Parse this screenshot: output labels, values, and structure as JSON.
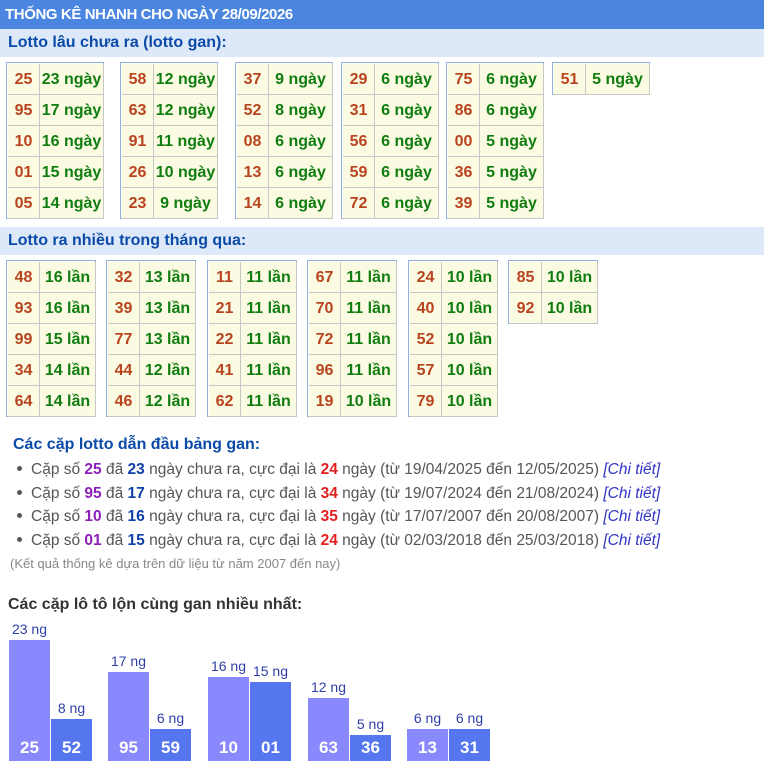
{
  "header": {
    "title": "THỐNG KÊ NHANH CHO NGÀY 28/09/2026"
  },
  "gan": {
    "title": "Lotto lâu chưa ra (lotto gan):",
    "groups": [
      [
        {
          "num": "25",
          "val": "23 ngày"
        },
        {
          "num": "95",
          "val": "17 ngày"
        },
        {
          "num": "10",
          "val": "16 ngày"
        },
        {
          "num": "01",
          "val": "15 ngày"
        },
        {
          "num": "05",
          "val": "14 ngày"
        }
      ],
      [
        {
          "num": "58",
          "val": "12 ngày"
        },
        {
          "num": "63",
          "val": "12 ngày"
        },
        {
          "num": "91",
          "val": "11 ngày"
        },
        {
          "num": "26",
          "val": "10 ngày"
        },
        {
          "num": "23",
          "val": "9 ngày"
        }
      ],
      [
        {
          "num": "37",
          "val": "9 ngày"
        },
        {
          "num": "52",
          "val": "8 ngày"
        },
        {
          "num": "08",
          "val": "6 ngày"
        },
        {
          "num": "13",
          "val": "6 ngày"
        },
        {
          "num": "14",
          "val": "6 ngày"
        }
      ],
      [
        {
          "num": "29",
          "val": "6 ngày"
        },
        {
          "num": "31",
          "val": "6 ngày"
        },
        {
          "num": "56",
          "val": "6 ngày"
        },
        {
          "num": "59",
          "val": "6 ngày"
        },
        {
          "num": "72",
          "val": "6 ngày"
        }
      ],
      [
        {
          "num": "75",
          "val": "6 ngày"
        },
        {
          "num": "86",
          "val": "6 ngày"
        },
        {
          "num": "00",
          "val": "5 ngày"
        },
        {
          "num": "36",
          "val": "5 ngày"
        },
        {
          "num": "39",
          "val": "5 ngày"
        }
      ],
      [
        {
          "num": "51",
          "val": "5 ngày"
        }
      ]
    ]
  },
  "frequent": {
    "title": "Lotto ra nhiều trong tháng qua:",
    "groups": [
      [
        {
          "num": "48",
          "val": "16 lần"
        },
        {
          "num": "93",
          "val": "16 lần"
        },
        {
          "num": "99",
          "val": "15 lần"
        },
        {
          "num": "34",
          "val": "14 lần"
        },
        {
          "num": "64",
          "val": "14 lần"
        }
      ],
      [
        {
          "num": "32",
          "val": "13 lần"
        },
        {
          "num": "39",
          "val": "13 lần"
        },
        {
          "num": "77",
          "val": "13 lần"
        },
        {
          "num": "44",
          "val": "12 lần"
        },
        {
          "num": "46",
          "val": "12 lần"
        }
      ],
      [
        {
          "num": "11",
          "val": "11 lần"
        },
        {
          "num": "21",
          "val": "11 lần"
        },
        {
          "num": "22",
          "val": "11 lần"
        },
        {
          "num": "41",
          "val": "11 lần"
        },
        {
          "num": "62",
          "val": "11 lần"
        }
      ],
      [
        {
          "num": "67",
          "val": "11 lần"
        },
        {
          "num": "70",
          "val": "11 lần"
        },
        {
          "num": "72",
          "val": "11 lần"
        },
        {
          "num": "96",
          "val": "11 lần"
        },
        {
          "num": "19",
          "val": "10 lần"
        }
      ],
      [
        {
          "num": "24",
          "val": "10 lần"
        },
        {
          "num": "40",
          "val": "10 lần"
        },
        {
          "num": "52",
          "val": "10 lần"
        },
        {
          "num": "57",
          "val": "10 lần"
        },
        {
          "num": "79",
          "val": "10 lần"
        }
      ],
      [
        {
          "num": "85",
          "val": "10 lần"
        },
        {
          "num": "92",
          "val": "10 lần"
        }
      ]
    ]
  },
  "pairs": {
    "title": "Các cặp lotto dẫn đầu bảng gan:",
    "items": [
      {
        "pair": "25",
        "days": "23",
        "max": "24",
        "from": "19/04/2025",
        "to": "12/05/2025",
        "pair_color": "#8b1fb8"
      },
      {
        "pair": "95",
        "days": "17",
        "max": "34",
        "from": "19/07/2024",
        "to": "21/08/2024",
        "pair_color": "#8b1fb8"
      },
      {
        "pair": "10",
        "days": "16",
        "max": "35",
        "from": "17/07/2007",
        "to": "20/08/2007",
        "pair_color": "#8b1fb8"
      },
      {
        "pair": "01",
        "days": "15",
        "max": "24",
        "from": "02/03/2018",
        "to": "25/03/2018",
        "pair_color": "#8b1fb8"
      }
    ],
    "text": {
      "prefix": "Cặp số ",
      "mid1": " đã ",
      "mid2": " ngày chưa ra, cực đại là ",
      "mid3": " ngày (từ ",
      "mid4": " đến ",
      "suffix": ") ",
      "detail": "[Chi tiết]"
    },
    "note": "(Kết quả thống kê dựa trên dữ liệu từ năm 2007 đến nay)"
  },
  "chart": {
    "title": "Các cặp lô tô lộn cùng gan nhiều nhất:",
    "unit": " ng"
  },
  "chart_data": {
    "type": "bar",
    "title": "Các cặp lô tô lộn cùng gan nhiều nhất:",
    "xlabel": "",
    "ylabel": "",
    "pairs": [
      [
        {
          "label": "25",
          "value": 23
        },
        {
          "label": "52",
          "value": 8
        }
      ],
      [
        {
          "label": "95",
          "value": 17
        },
        {
          "label": "59",
          "value": 6
        }
      ],
      [
        {
          "label": "10",
          "value": 16
        },
        {
          "label": "01",
          "value": 15
        }
      ],
      [
        {
          "label": "63",
          "value": 12
        },
        {
          "label": "36",
          "value": 5
        }
      ],
      [
        {
          "label": "13",
          "value": 6
        },
        {
          "label": "31",
          "value": 6
        }
      ]
    ],
    "colors": [
      "#8a88fd",
      "#5576ee"
    ]
  }
}
